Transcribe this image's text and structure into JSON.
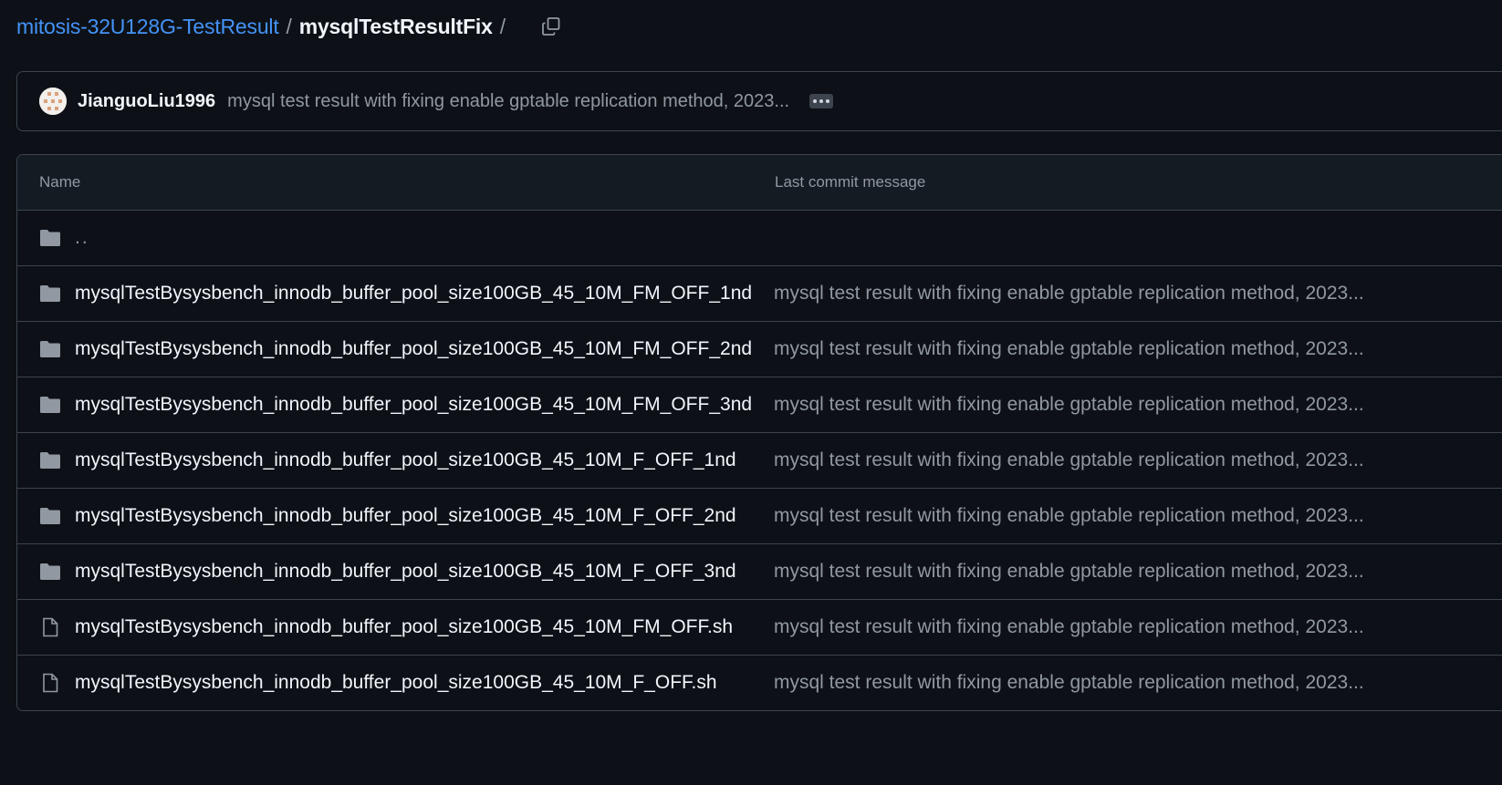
{
  "breadcrumb": {
    "repo": "mitosis-32U128G-TestResult",
    "separator": "/",
    "current": "mysqlTestResultFix",
    "trailing_separator": "/"
  },
  "commit": {
    "author": "JianguoLiu1996",
    "message": "mysql test result with fixing enable gptable replication method, 2023..."
  },
  "table": {
    "headers": {
      "name": "Name",
      "message": "Last commit message"
    },
    "parent": "..",
    "rows": [
      {
        "type": "folder",
        "name": "mysqlTestBysysbench_innodb_buffer_pool_size100GB_45_10M_FM_OFF_1nd",
        "message": "mysql test result with fixing enable gptable replication method, 2023..."
      },
      {
        "type": "folder",
        "name": "mysqlTestBysysbench_innodb_buffer_pool_size100GB_45_10M_FM_OFF_2nd",
        "message": "mysql test result with fixing enable gptable replication method, 2023..."
      },
      {
        "type": "folder",
        "name": "mysqlTestBysysbench_innodb_buffer_pool_size100GB_45_10M_FM_OFF_3nd",
        "message": "mysql test result with fixing enable gptable replication method, 2023..."
      },
      {
        "type": "folder",
        "name": "mysqlTestBysysbench_innodb_buffer_pool_size100GB_45_10M_F_OFF_1nd",
        "message": "mysql test result with fixing enable gptable replication method, 2023..."
      },
      {
        "type": "folder",
        "name": "mysqlTestBysysbench_innodb_buffer_pool_size100GB_45_10M_F_OFF_2nd",
        "message": "mysql test result with fixing enable gptable replication method, 2023..."
      },
      {
        "type": "folder",
        "name": "mysqlTestBysysbench_innodb_buffer_pool_size100GB_45_10M_F_OFF_3nd",
        "message": "mysql test result with fixing enable gptable replication method, 2023..."
      },
      {
        "type": "file",
        "name": "mysqlTestBysysbench_innodb_buffer_pool_size100GB_45_10M_FM_OFF.sh",
        "message": "mysql test result with fixing enable gptable replication method, 2023..."
      },
      {
        "type": "file",
        "name": "mysqlTestBysysbench_innodb_buffer_pool_size100GB_45_10M_F_OFF.sh",
        "message": "mysql test result with fixing enable gptable replication method, 2023..."
      }
    ]
  },
  "colors": {
    "background": "#0d1117",
    "link": "#4493f8",
    "muted": "#9198a1",
    "border": "#3d444d"
  }
}
